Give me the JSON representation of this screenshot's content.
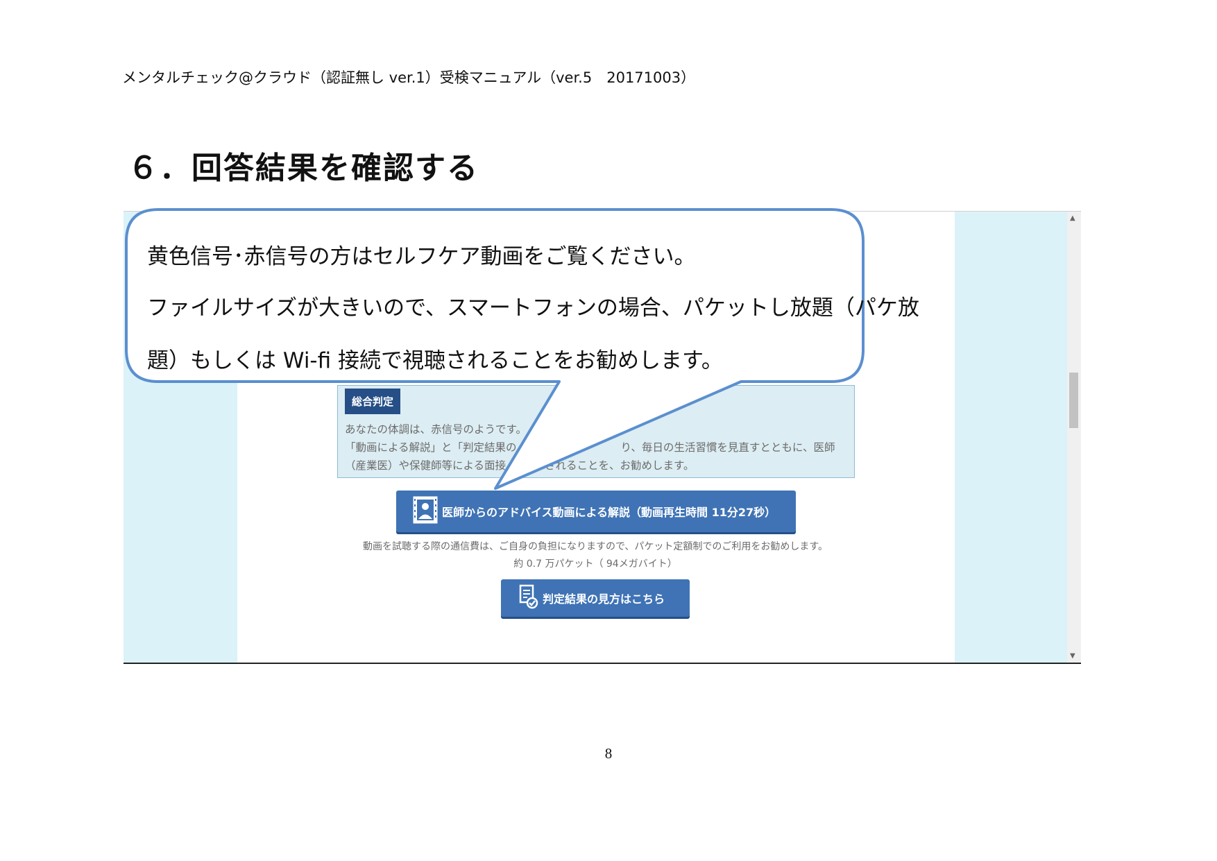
{
  "header": {
    "text": "メンタルチェック@クラウド（認証無し ver.1）受検マニュアル（ver.5　20171003）"
  },
  "section": {
    "title": "６．回答結果を確認する"
  },
  "screenshot": {
    "result_box": {
      "badge": "総合判定",
      "lines": [
        "あなたの体調は、赤信号のようです。",
        "「動画による解説」と「判定結果の",
        "り、毎日の生活習慣を見直すとともに、医師",
        "（産業医）や保健師等による面接",
        "されることを、お勧めします。"
      ]
    },
    "video_button": {
      "label": "医師からのアドバイス動画による解説（動画再生時間 11分27秒）"
    },
    "notes": {
      "line1": "動画を試聴する際の通信費は、ご自身の負担になりますので、パケット定額制でのご利用をお勧めします。",
      "line2": "約 0.7 万パケット（ 94メガバイト）"
    },
    "guide_button": {
      "label": "判定結果の見方はこちら"
    }
  },
  "callout": {
    "line1": "黄色信号･赤信号の方はセルフケア動画をご覧ください。",
    "line2": "ファイルサイズが大きいので、スマートフォンの場合、パケットし放題（パケ放",
    "line3": "題）もしくは Wi-fi  接続で視聴されることをお勧めします。"
  },
  "page_number": "8",
  "colors": {
    "side_panel": "#dbf2f8",
    "button_blue": "#3f73b5",
    "badge_navy": "#254f86",
    "callout_border": "#5b8fcf"
  },
  "icons": {
    "video_button": "doctor-video-icon",
    "guide_button": "document-check-icon"
  }
}
